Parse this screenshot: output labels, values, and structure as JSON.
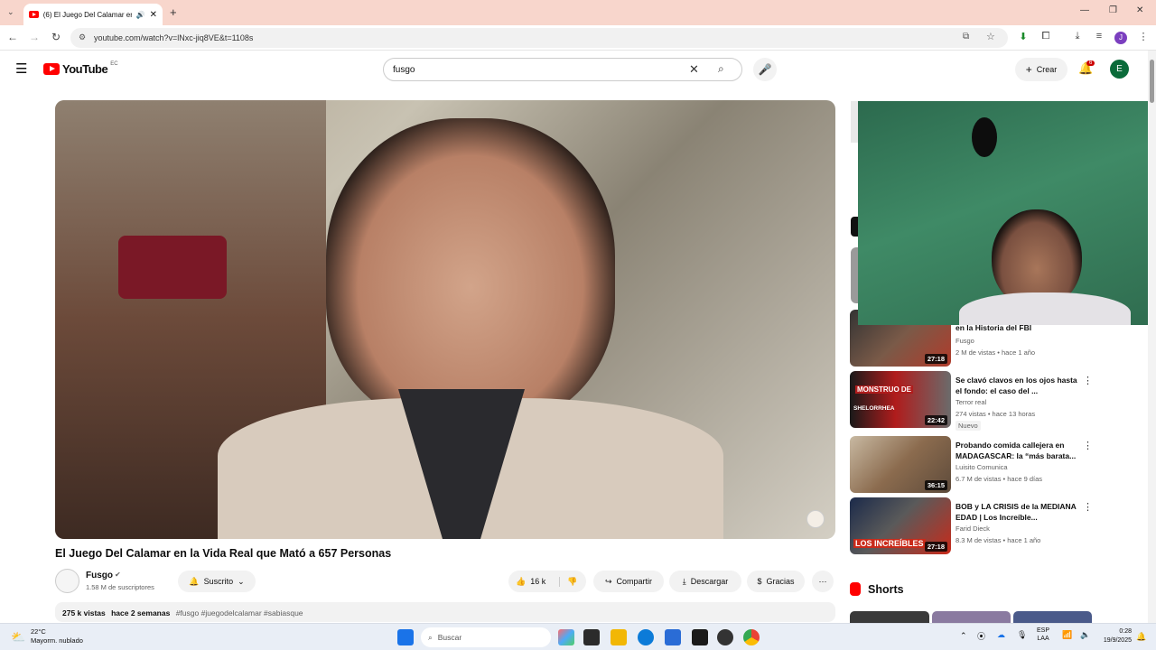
{
  "browser": {
    "tab_title": "(6) El Juego Del Calamar en",
    "url": "youtube.com/watch?v=lNxc-jiq8VE&t=1108s",
    "new_tab": "+"
  },
  "youtube": {
    "logo_text": "YouTube",
    "logo_region": "EC",
    "search_value": "fusgo",
    "create_label": "Crear",
    "notifications_count": "6",
    "avatar_letter": "E"
  },
  "video": {
    "title": "El Juego Del Calamar en la Vida Real que Mató a 657 Personas",
    "channel_name": "Fusgo",
    "subscribers": "1.58 M de suscriptores",
    "subscribed_label": "Suscrito",
    "likes": "16 k",
    "share_label": "Compartir",
    "download_label": "Descargar",
    "thanks_label": "Gracias",
    "views": "275 k vistas",
    "date": "hace 2 semanas",
    "hashtags": "#fusgo #juegodelcalamar #sabiasque"
  },
  "sidebar": {
    "videos": [
      {
        "title": "en la Historia del FBI",
        "channel": "Fusgo",
        "meta": "2 M de vistas • hace 1 año",
        "duration": "27:18",
        "badge": "",
        "thumb_color": "#6b4a3a"
      },
      {
        "title": "Se clavó clavos en los ojos hasta el fondo: el caso del ...",
        "channel": "Terror real",
        "meta": "274 vistas • hace 13 horas",
        "duration": "22:42",
        "badge": "Nuevo",
        "thumb_text": "MONSTRUO DE",
        "thumb_text2": "SHELORRHEA",
        "thumb_color": "#b01c1c"
      },
      {
        "title": "Probando comida callejera en MADAGASCAR: la “más barata...",
        "channel": "Luisito Comunica",
        "meta": "6.7 M de vistas • hace 9 días",
        "duration": "36:15",
        "badge": "",
        "thumb_color": "#7a6a55"
      },
      {
        "title": "BOB y LA CRISIS de la MEDIANA EDAD | Los Increíble...",
        "channel": "Farid Dieck",
        "meta": "8.3 M de vistas • hace 1 año",
        "duration": "27:18",
        "badge": "",
        "thumb_text": "LOS INCREÍBLES",
        "thumb_color": "#c92a1a"
      }
    ],
    "shorts_label": "Shorts"
  },
  "taskbar": {
    "weather_temp": "22°C",
    "weather_desc": "Mayorm. nublado",
    "search_placeholder": "Buscar",
    "lang_1": "ESP",
    "lang_2": "LAA",
    "time": "0:28",
    "date": "19/9/2025"
  }
}
